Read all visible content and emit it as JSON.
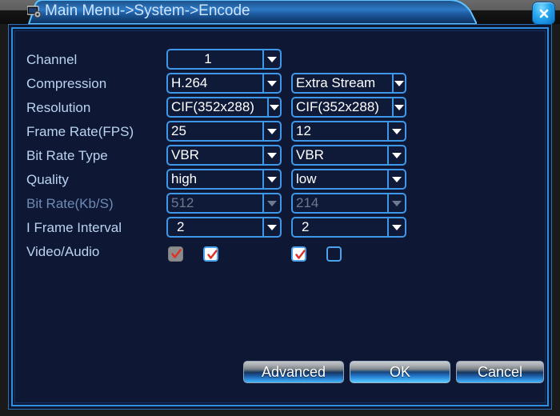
{
  "window": {
    "title": "Main Menu->System->Encode",
    "title_icon": "encode-monitor-icon",
    "close_icon": "close-icon"
  },
  "colors": {
    "accent_blue": "#3e97e8",
    "panel_bg": "#0e1733",
    "label_text": "#b9d4f2",
    "label_text_disabled": "#6d8bb4",
    "value_text": "#ffffff",
    "value_text_disabled": "#6d7b90",
    "check_red": "#e03025",
    "titlebar_gray": "#5e5e5e"
  },
  "form": {
    "rows": [
      {
        "label": "Channel",
        "disabled": false,
        "main": {
          "value": "1",
          "align": "center"
        },
        "extra": null
      },
      {
        "label": "Compression",
        "disabled": false,
        "main": {
          "value": "H.264",
          "align": "left"
        },
        "extra": {
          "value": "Extra Stream",
          "align": "left"
        }
      },
      {
        "label": "Resolution",
        "disabled": false,
        "main": {
          "value": "CIF(352x288)",
          "align": "left"
        },
        "extra": {
          "value": "CIF(352x288)",
          "align": "left"
        }
      },
      {
        "label": "Frame Rate(FPS)",
        "disabled": false,
        "main": {
          "value": "25",
          "align": "left"
        },
        "extra": {
          "value": "12",
          "align": "left"
        }
      },
      {
        "label": "Bit Rate Type",
        "disabled": false,
        "main": {
          "value": "VBR",
          "align": "left"
        },
        "extra": {
          "value": "VBR",
          "align": "left"
        }
      },
      {
        "label": "Quality",
        "disabled": false,
        "main": {
          "value": "high",
          "align": "left"
        },
        "extra": {
          "value": "low",
          "align": "left"
        }
      },
      {
        "label": "Bit Rate(Kb/S)",
        "disabled": true,
        "main": {
          "value": "512",
          "align": "left"
        },
        "extra": {
          "value": "214",
          "align": "left"
        }
      },
      {
        "label": "I Frame Interval",
        "disabled": false,
        "main": {
          "value": "2",
          "align": "indent"
        },
        "extra": {
          "value": "2",
          "align": "indent"
        }
      }
    ],
    "video_audio": {
      "label": "Video/Audio",
      "checkboxes": [
        {
          "name": "main-video",
          "state": "checked-disabled"
        },
        {
          "name": "main-audio",
          "state": "checked"
        },
        {
          "name": "extra-video",
          "state": "checked"
        },
        {
          "name": "extra-audio",
          "state": "unchecked"
        }
      ]
    }
  },
  "footer": {
    "buttons": [
      {
        "name": "advanced",
        "label": "Advanced",
        "focused": false
      },
      {
        "name": "ok",
        "label": "OK",
        "focused": true
      },
      {
        "name": "cancel",
        "label": "Cancel",
        "focused": false
      }
    ]
  }
}
